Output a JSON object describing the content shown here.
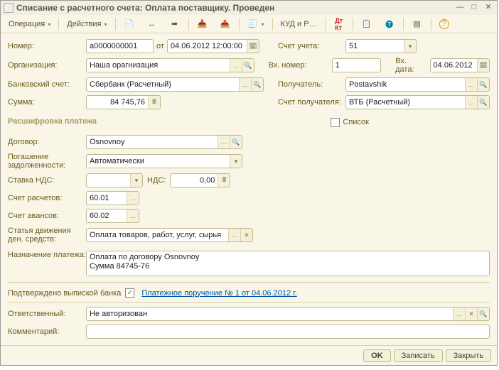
{
  "title": "Списание с расчетного счета: Оплата поставщику. Проведен",
  "toolbar": {
    "operation": "Операция",
    "actions": "Действия",
    "kudir": "КУД и Р…"
  },
  "labels": {
    "number": "Номер:",
    "from": "от",
    "org": "Организация:",
    "bank_account": "Банковский счет:",
    "sum": "Сумма:",
    "account": "Счет учета:",
    "in_number": "Вх. номер:",
    "in_date": "Вх. дата:",
    "receiver": "Получатель:",
    "receiver_account": "Счет получателя:",
    "list": "Список",
    "section": "Расшифровка платежа",
    "contract": "Договор:",
    "debt": "Погашение задолженности:",
    "vat_rate": "Ставка НДС:",
    "vat": "НДС:",
    "settlement": "Счет расчетов:",
    "advance": "Счет авансов:",
    "dds": "Статья движения ден. средств:",
    "purpose": "Назначение платежа:",
    "confirmed": "Подтверждено выпиской банка",
    "payment_order": "Платежное поручение № 1 от 04.06.2012 г.",
    "responsible": "Ответственный:",
    "comment": "Комментарий:"
  },
  "values": {
    "number": "а0000000001",
    "date": "04.06.2012 12:00:00",
    "org": "Наша орагнизация",
    "bank_account": "Сбербанк (Расчетный)",
    "sum": "84 745,76",
    "account": "51",
    "in_number": "1",
    "in_date": "04.06.2012",
    "receiver": "Postavshik",
    "receiver_account": "ВТБ (Расчетный)",
    "contract": "Osnovnoy",
    "debt": "Автоматически",
    "vat_rate": "",
    "vat": "0,00",
    "settlement": "60.01",
    "advance": "60.02",
    "dds": "Оплата товаров, работ, услуг, сырья",
    "purpose": "Оплата по договору Osnovnoy\nСумма 84745-76",
    "responsible": "Не авторизован",
    "comment": ""
  },
  "footer": {
    "ok": "OK",
    "write": "Записать",
    "close": "Закрыть"
  }
}
